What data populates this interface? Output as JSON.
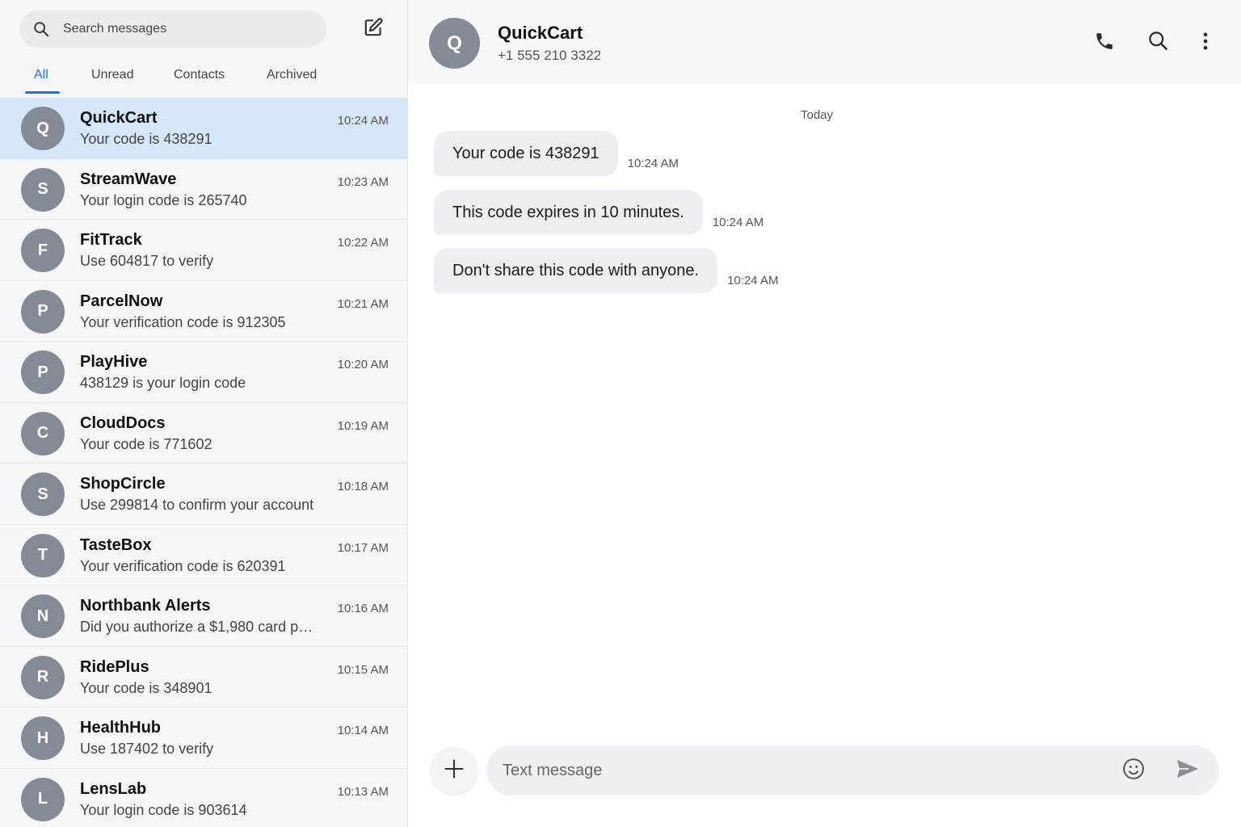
{
  "search": {
    "placeholder": "Search messages"
  },
  "tabs": [
    {
      "label": "All",
      "active": true
    },
    {
      "label": "Unread",
      "active": false
    },
    {
      "label": "Contacts",
      "active": false
    },
    {
      "label": "Archived",
      "active": false
    }
  ],
  "conversations": [
    {
      "initial": "Q",
      "name": "QuickCart",
      "preview": "Your code is 438291",
      "time": "10:24 AM",
      "selected": true
    },
    {
      "initial": "S",
      "name": "StreamWave",
      "preview": "Your login code is 265740",
      "time": "10:23 AM",
      "selected": false
    },
    {
      "initial": "F",
      "name": "FitTrack",
      "preview": "Use 604817 to verify",
      "time": "10:22 AM",
      "selected": false
    },
    {
      "initial": "P",
      "name": "ParcelNow",
      "preview": "Your verification code is 912305",
      "time": "10:21 AM",
      "selected": false
    },
    {
      "initial": "P",
      "name": "PlayHive",
      "preview": "438129 is your login code",
      "time": "10:20 AM",
      "selected": false
    },
    {
      "initial": "C",
      "name": "CloudDocs",
      "preview": "Your code is 771602",
      "time": "10:19 AM",
      "selected": false
    },
    {
      "initial": "S",
      "name": "ShopCircle",
      "preview": "Use 299814 to confirm your account",
      "time": "10:18 AM",
      "selected": false
    },
    {
      "initial": "T",
      "name": "TasteBox",
      "preview": "Your verification code is 620391",
      "time": "10:17 AM",
      "selected": false
    },
    {
      "initial": "N",
      "name": "Northbank Alerts",
      "preview": "Did you authorize a $1,980 card pur...",
      "time": "10:16 AM",
      "selected": false
    },
    {
      "initial": "R",
      "name": "RidePlus",
      "preview": "Your code is 348901",
      "time": "10:15 AM",
      "selected": false
    },
    {
      "initial": "H",
      "name": "HealthHub",
      "preview": "Use 187402 to verify",
      "time": "10:14 AM",
      "selected": false
    },
    {
      "initial": "L",
      "name": "LensLab",
      "preview": "Your login code is 903614",
      "time": "10:13 AM",
      "selected": false
    }
  ],
  "chat": {
    "contact_initial": "Q",
    "contact_name": "QuickCart",
    "contact_phone": "+1 555 210 3322",
    "day_label": "Today",
    "messages": [
      {
        "text": "Your code is 438291",
        "time": "10:24 AM"
      },
      {
        "text": "This code expires in 10 minutes.",
        "time": "10:24 AM"
      },
      {
        "text": "Don't share this code with anyone.",
        "time": "10:24 AM"
      }
    ]
  },
  "composer": {
    "placeholder": "Text message"
  },
  "colors": {
    "accent": "#1a73e8",
    "selected_row": "#d6e6fb",
    "avatar": "#858b94",
    "bubble": "#eceef1"
  },
  "icons": {
    "search": "search-icon",
    "compose": "compose-icon",
    "call": "phone-icon",
    "chat_search": "search-icon",
    "more": "more-vertical-icon",
    "attach": "plus-icon",
    "emoji": "emoji-icon",
    "send": "send-icon"
  }
}
